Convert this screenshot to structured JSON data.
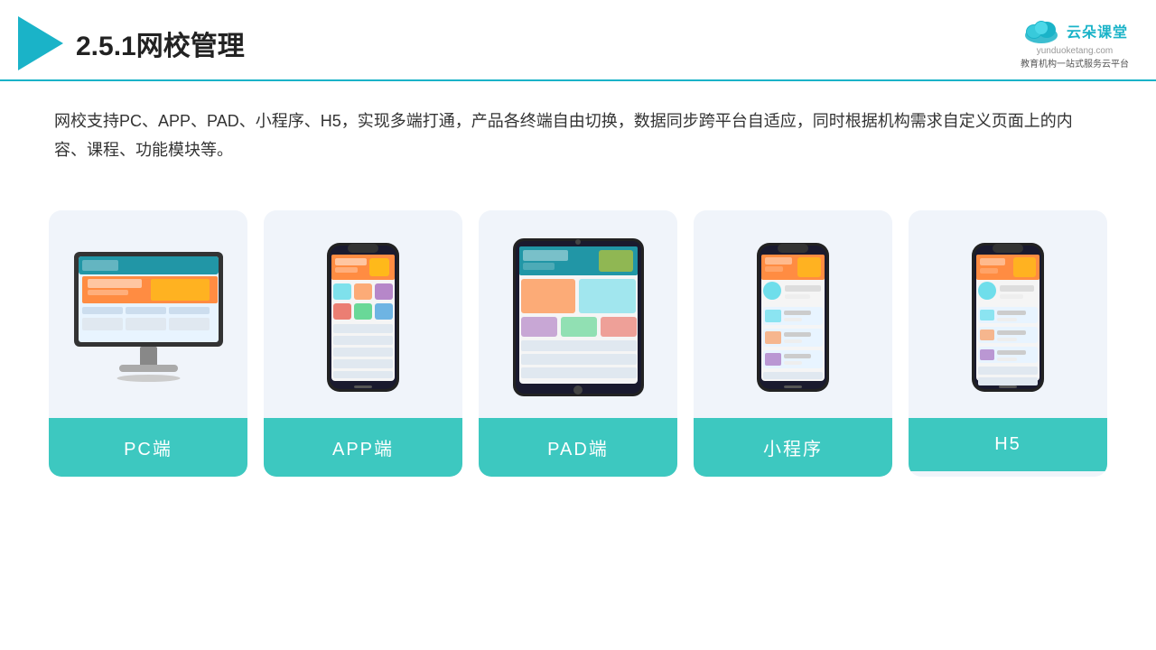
{
  "header": {
    "title": "2.5.1网校管理",
    "brand_name": "云朵课堂",
    "brand_url": "yunduoketang.com",
    "brand_tagline": "教育机构一站\n式服务云平台"
  },
  "description": {
    "text": "网校支持PC、APP、PAD、小程序、H5，实现多端打通，产品各终端自由切换，数据同步跨平台自适应，同时根据机构需求自定义页面上的内容、课程、功能模块等。"
  },
  "cards": [
    {
      "id": "pc",
      "label": "PC端"
    },
    {
      "id": "app",
      "label": "APP端"
    },
    {
      "id": "pad",
      "label": "PAD端"
    },
    {
      "id": "mini",
      "label": "小程序"
    },
    {
      "id": "h5",
      "label": "H5"
    }
  ],
  "accent_color": "#3dc8c0",
  "bg_card": "#f0f4fa"
}
